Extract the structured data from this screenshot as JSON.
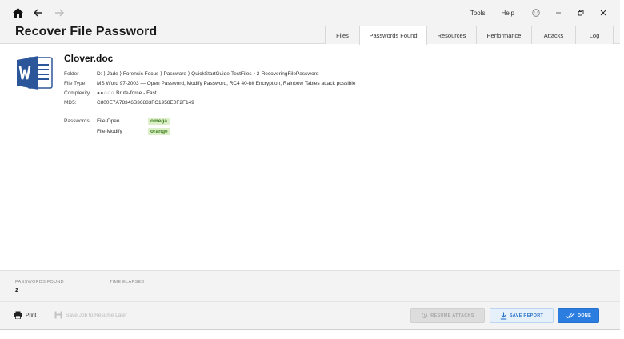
{
  "header": {
    "title": "Recover File Password",
    "menu": {
      "tools": "Tools",
      "help": "Help"
    },
    "tabs": [
      {
        "label": "Files",
        "active": false
      },
      {
        "label": "Passwords Found",
        "active": true
      },
      {
        "label": "Resources",
        "active": false
      },
      {
        "label": "Performance",
        "active": false
      },
      {
        "label": "Attacks",
        "active": false
      },
      {
        "label": "Log",
        "active": false
      }
    ]
  },
  "file": {
    "name": "Clover.doc",
    "icon": "word-document-icon",
    "details": [
      {
        "key": "Folder",
        "value": "D: ⟩ Jade ⟩ Forensic Focus ⟩ Passware ⟩ QuickStartGuide-TestFiles ⟩ 2-RecoveringFilePassword"
      },
      {
        "key": "File Type",
        "value": "MS Word 97-2003 — Open Password, Modify Password, RC4 40-bit Encryption, Rainbow Tables attack possible"
      },
      {
        "key": "Complexity",
        "dots": "●●○○○",
        "value": "Brute-force - Fast"
      },
      {
        "key": "MD5:",
        "value": "C800E7A78346B36883FC1958E0F2F149"
      }
    ],
    "passwords_label": "Passwords",
    "passwords": [
      {
        "type": "File-Open",
        "value": "omega"
      },
      {
        "type": "File-Modify",
        "value": "orange"
      }
    ]
  },
  "status": {
    "passwords_found_label": "PASSWORDS FOUND",
    "passwords_found_value": "2",
    "time_elapsed_label": "TIME ELAPSED"
  },
  "footer": {
    "print": "Print",
    "save_job": "Save Job to Resume Later",
    "resume": "RESUME ATTACKS",
    "save_report": "SAVE REPORT",
    "done": "DONE"
  },
  "colors": {
    "accent": "#2b7de0",
    "password_badge_bg": "#dcefc9",
    "password_badge_text": "#3b7d1c",
    "word_blue": "#2b579a"
  }
}
